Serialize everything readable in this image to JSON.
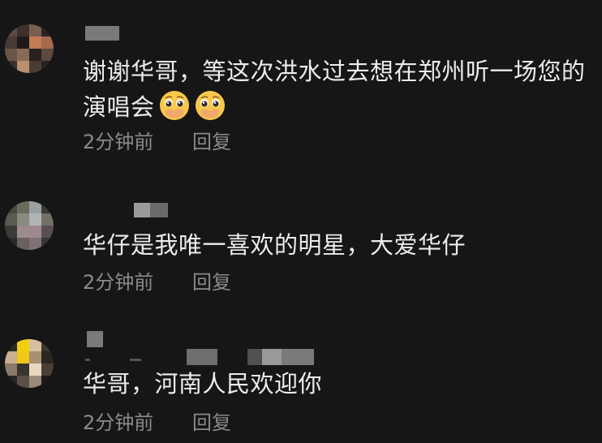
{
  "comments": [
    {
      "text": "谢谢华哥，等这次洪水过去想在郑州听一场您的演唱会",
      "emojis": [
        "pleading-face-emoji",
        "pleading-face-emoji"
      ],
      "time": "2分钟前",
      "reply_label": "回复"
    },
    {
      "text": "华仔是我唯一喜欢的明星，大爱华仔",
      "time": "2分钟前",
      "reply_label": "回复"
    },
    {
      "text": "华哥，河南人民欢迎你",
      "time": "2分钟前",
      "reply_label": "回复"
    }
  ],
  "colors": {
    "background": "#161616",
    "text": "#ececec",
    "meta": "#8a8a8a",
    "emoji_face": "#f7c84a"
  }
}
